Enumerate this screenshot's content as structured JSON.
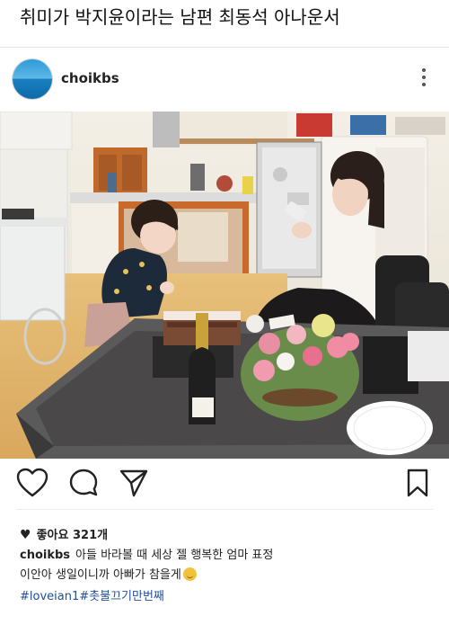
{
  "headline": "취미가 박지윤이라는 남편 최동석 아나운서",
  "post": {
    "username": "choikbs",
    "likes_label": "좋아요",
    "likes_count": "321개",
    "caption_username": "choikbs",
    "caption_line1": "아들 바라볼 때 세상 젤 행복한 엄마 표정",
    "caption_line2": "이안아 생일이니까 아빠가 참을게",
    "tags": [
      "#loveian1",
      "#촛불끄기만번째"
    ]
  },
  "icons": {
    "more": "more-vertical-icon",
    "like": "heart-icon",
    "comment": "comment-bubble-icon",
    "share": "paper-plane-icon",
    "save": "bookmark-icon",
    "emoji": "grimace-emoji-icon"
  }
}
